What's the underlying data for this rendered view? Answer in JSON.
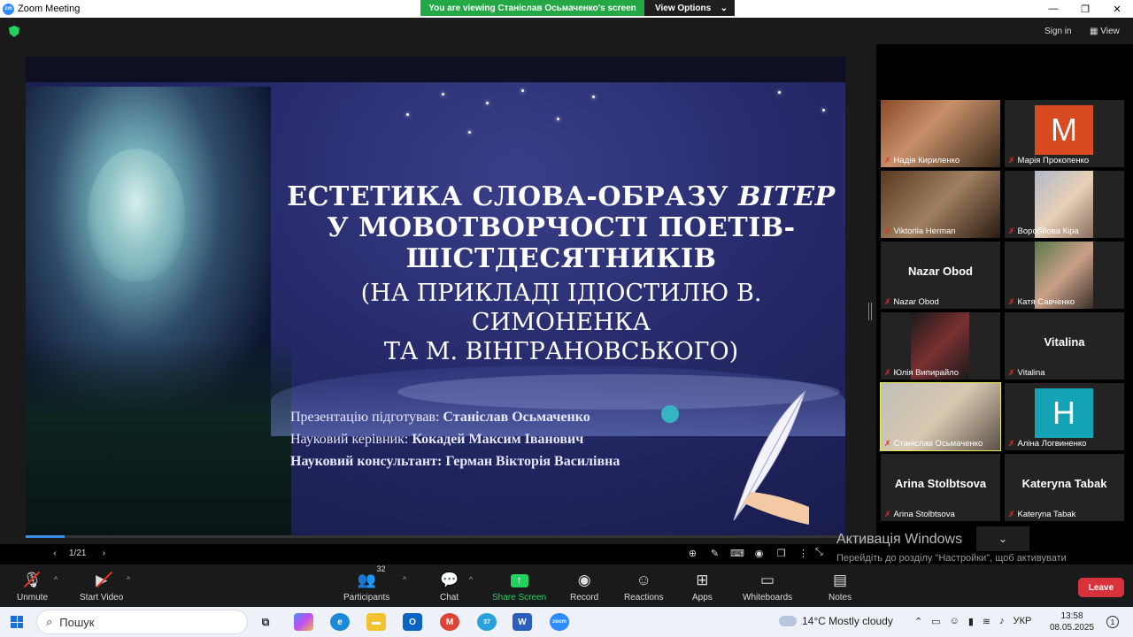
{
  "window": {
    "title": "Zoom Meeting",
    "minimize": "—",
    "maximize": "❐",
    "close": "✕"
  },
  "banner": {
    "message": "You are viewing Станіслав Осьмаченко's screen",
    "options": "View Options",
    "options_caret": "⌄"
  },
  "top": {
    "sign_in": "Sign in",
    "view": "View",
    "view_icon": "▦"
  },
  "slide": {
    "title_line1a": "ЕСТЕТИКА СЛОВА-ОБРАЗУ ",
    "title_line1b": "ВІТЕР",
    "title_line2": "У МОВОТВОРЧОСТІ ПОЕТІВ-",
    "title_line3": "ШІСТДЕСЯТНИКІВ",
    "subtitle_line1": "(НА ПРИКЛАДІ ІДІОСТИЛЮ В. СИМОНЕНКА",
    "subtitle_line2": "ТА М. ВІНГРАНОВСЬКОГО)",
    "credit1_label": "Презентацію підготував: ",
    "credit1_value": "Станіслав Осьмаченко",
    "credit2_label": "Науковий керівник: ",
    "credit2_value": "Кокадей Максим Іванович",
    "credit3_label": "Науковий консультант: ",
    "credit3_value": "Герман Вікторія Василівна",
    "page": "1/21",
    "progress_fraction": 0.0476
  },
  "slide_nav": {
    "prev": "‹",
    "next": "›"
  },
  "participants": [
    {
      "name": "Надія Кириленко",
      "type": "video"
    },
    {
      "name": "Марія Прокопенко",
      "type": "avatar",
      "letter": "M",
      "color": "#d84b20"
    },
    {
      "name": "Viktoriia Herman",
      "type": "video"
    },
    {
      "name": "Воробйова Кіра",
      "type": "video"
    },
    {
      "name": "Nazar Obod",
      "type": "text",
      "big": "Nazar Obod"
    },
    {
      "name": "Катя Савченко",
      "type": "video"
    },
    {
      "name": "Юлія Випирайло",
      "type": "video"
    },
    {
      "name": "Vitalina",
      "type": "text",
      "big": "Vitalina"
    },
    {
      "name": "Станіслав Осьмаченко",
      "type": "video",
      "active": true
    },
    {
      "name": "Аліна Логвиненко",
      "type": "avatar",
      "letter": "H",
      "color": "#13a3b4"
    },
    {
      "name": "Arina Stolbtsova",
      "type": "text",
      "big": "Arina Stolbtsova"
    },
    {
      "name": "Kateryna Tabak",
      "type": "text",
      "big": "Kateryna Tabak"
    }
  ],
  "activation": {
    "title": "Активація Windows",
    "subtitle": "Перейдіть до розділу \"Настройки\", щоб активувати Windows."
  },
  "toolbar": {
    "unmute": "Unmute",
    "start_video": "Start Video",
    "participants": "Participants",
    "participants_count": "32",
    "chat": "Chat",
    "share_screen": "Share Screen",
    "record": "Record",
    "reactions": "Reactions",
    "apps": "Apps",
    "whiteboards": "Whiteboards",
    "notes": "Notes",
    "leave": "Leave",
    "caret": "^"
  },
  "taskbar": {
    "search_placeholder": "Пошук",
    "weather": "14°C  Mostly cloudy",
    "lang": "УКР",
    "time": "13:58",
    "date": "08.05.2025",
    "notif_count": "1",
    "chrome_badge": "M",
    "telegram_badge": "37"
  },
  "colors": {
    "accent_green": "#23a845",
    "leave_red": "#d8333a",
    "active_outline": "#e6e94f",
    "zoom_blue": "#2d8cff"
  }
}
